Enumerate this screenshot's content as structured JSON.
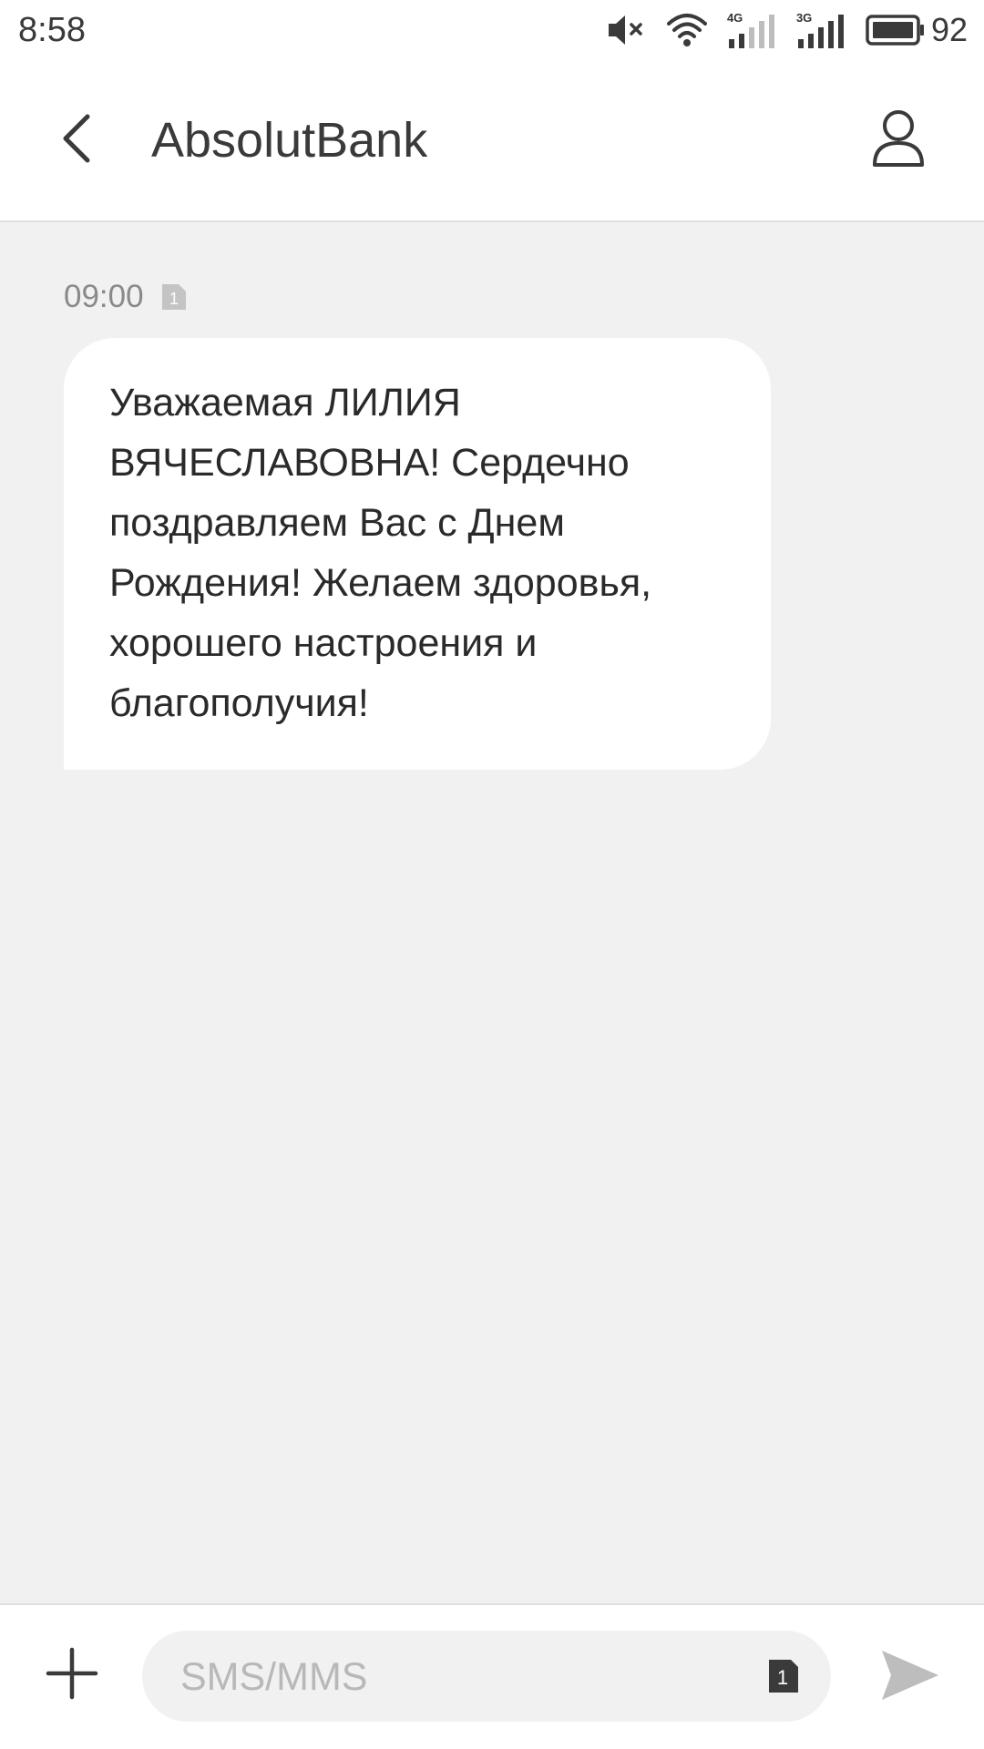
{
  "status_bar": {
    "time": "8:58",
    "icons": [
      "mute-icon",
      "wifi-icon",
      "signal-4g-icon",
      "signal-3g-icon",
      "battery-icon"
    ],
    "network_4g_label": "4G",
    "network_3g_label": "3G",
    "battery_level": "92"
  },
  "header": {
    "back_icon": "chevron-left-icon",
    "contact_name": "AbsolutBank",
    "contact_icon": "person-icon"
  },
  "conversation": {
    "messages": [
      {
        "time": "09:00",
        "sim_label": "1",
        "text": "Уважаемая ЛИЛИЯ ВЯЧЕСЛАВОВНА! Сердечно поздравляем Вас с Днем Рождения! Желаем здоровья, хорошего настроения и благополучия!"
      }
    ]
  },
  "composer": {
    "attach_icon": "plus-icon",
    "input_value": "",
    "input_placeholder": "SMS/MMS",
    "sim_label": "1",
    "send_icon": "send-icon"
  },
  "colors": {
    "background": "#f1f1f1",
    "bar_background": "#ffffff",
    "text": "#2a2a2a",
    "muted_text": "#8a8a8a",
    "placeholder": "#b8b8b8"
  }
}
